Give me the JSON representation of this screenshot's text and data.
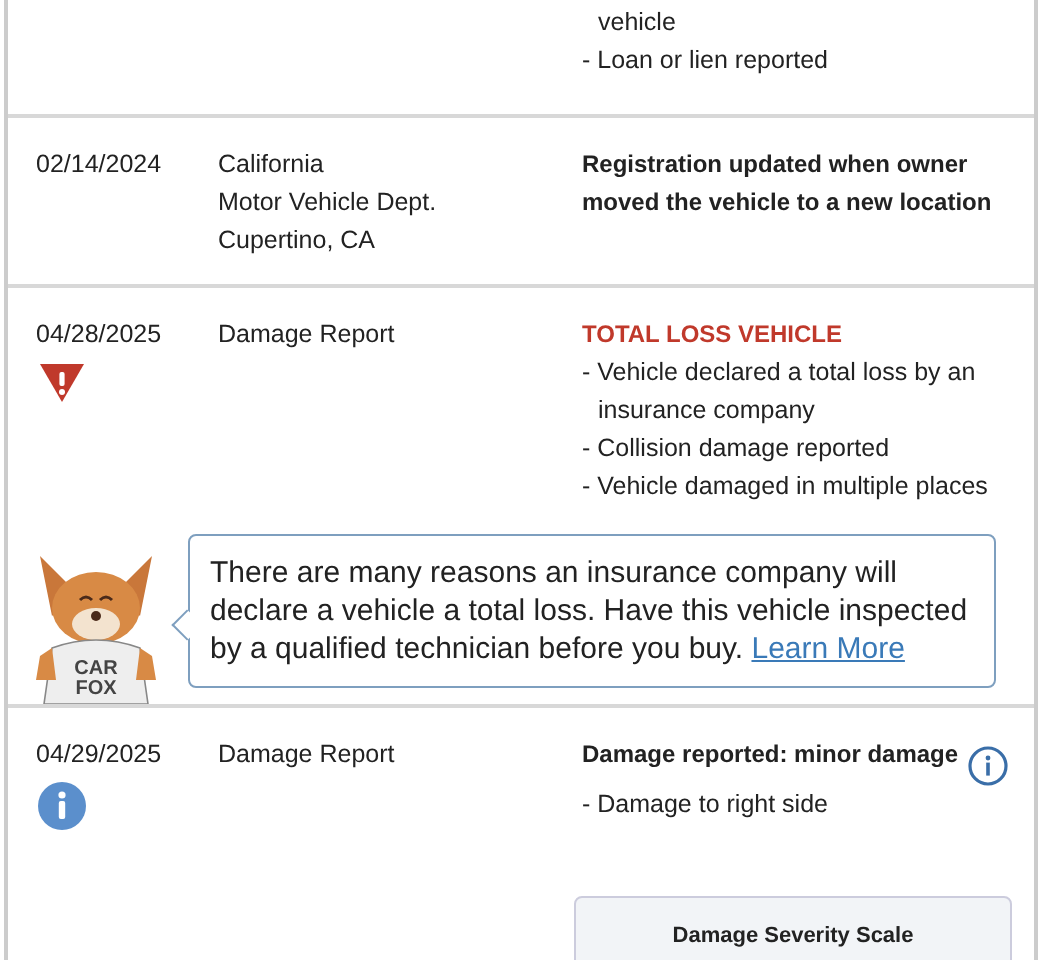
{
  "records": [
    {
      "kind": "plain",
      "info_button": false,
      "items": [
        {
          "text": "vehicle",
          "continued": true
        },
        {
          "text": "- Loan or lien reported",
          "continued": false
        }
      ]
    },
    {
      "kind": "plain",
      "date": "02/14/2024",
      "source_lines": [
        "California",
        "Motor Vehicle Dept.",
        "Cupertino, CA"
      ],
      "headline": "Registration updated when owner moved the vehicle to a new location",
      "info_button": false
    },
    {
      "kind": "alert",
      "date": "04/28/2025",
      "source_lines": [
        "Damage Report"
      ],
      "headline": "TOTAL LOSS VEHICLE",
      "info_button": false,
      "items": [
        {
          "text": "- Vehicle declared a total loss by an insurance company",
          "continued": false
        },
        {
          "text": "- Collision damage reported",
          "continued": false
        },
        {
          "text": "- Vehicle damaged in multiple places",
          "continued": false
        }
      ],
      "callout": {
        "text": "There are many reasons an insurance company will declare a vehicle a total loss. Have this vehicle inspected by a qualified technician before you buy.",
        "link": "Learn More",
        "mascot_shirt": [
          "CAR",
          "FOX"
        ]
      }
    },
    {
      "kind": "info",
      "date": "04/29/2025",
      "source_lines": [
        "Damage Report"
      ],
      "headline": "Damage reported: minor damage",
      "info_button": true,
      "items": [
        {
          "text": "- Damage to right side",
          "continued": false
        }
      ],
      "scale": {
        "title": "Damage Severity Scale"
      }
    }
  ]
}
